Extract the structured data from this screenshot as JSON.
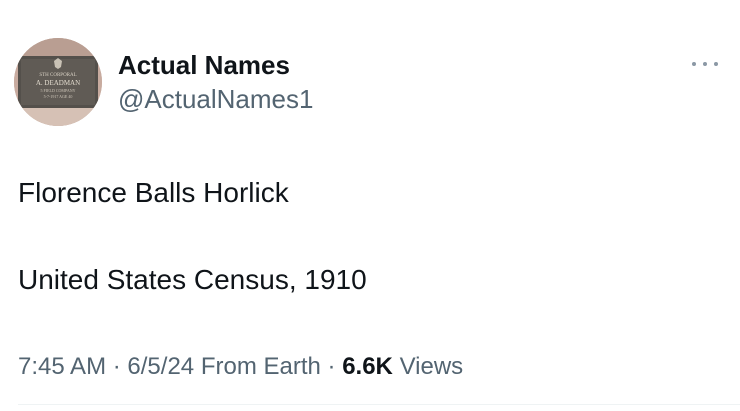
{
  "author": {
    "display_name": "Actual Names",
    "handle": "@ActualNames1",
    "avatar_text": [
      "STH CORPORAL",
      "A. DEADMAN",
      "5 FIELD COMPANY",
      "5-7-1917 AGE 40"
    ]
  },
  "tweet": {
    "lines": [
      "Florence Balls Horlick",
      "United States Census, 1910"
    ]
  },
  "meta": {
    "time": "7:45 AM",
    "separator": "·",
    "date": "6/5/24",
    "source": "From Earth",
    "views_count": "6.6K",
    "views_label": "Views"
  },
  "icons": {
    "more": "more-horizontal-icon"
  },
  "colors": {
    "text_primary": "#0f1419",
    "text_secondary": "#536471",
    "divider": "#eff3f4"
  }
}
